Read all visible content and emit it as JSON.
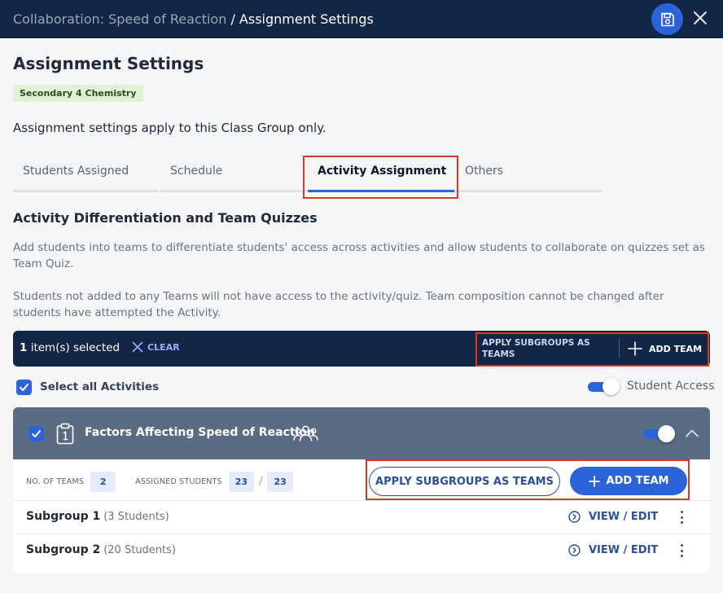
{
  "header": {
    "breadcrumb_parent": "Collaboration: Speed of Reaction",
    "breadcrumb_current": " / Assignment Settings"
  },
  "page": {
    "title": "Assignment Settings",
    "tag": "Secondary 4 Chemistry",
    "note": "Assignment settings apply to this Class Group only."
  },
  "tabs": [
    {
      "label": "Students Assigned",
      "active": false
    },
    {
      "label": "Schedule",
      "active": false
    },
    {
      "label": "Activity Assignment",
      "active": true
    },
    {
      "label": "Others",
      "active": false
    }
  ],
  "section": {
    "title": "Activity Differentiation and Team Quizzes",
    "para1": "Add students into teams to differentiate students' access across activities and allow students to collaborate on quizzes set as Team Quiz.",
    "para2": "Students not added to any Teams will not have access to the activity/quiz. Team composition cannot be changed after students have attempted the Activity."
  },
  "selection_bar": {
    "count": "1",
    "count_suffix": " item(s) selected",
    "clear_label": "CLEAR",
    "apply_label": "APPLY SUBGROUPS AS TEAMS",
    "add_label": "ADD TEAM"
  },
  "select_all": {
    "label": "Select all Activities",
    "checked": true
  },
  "student_access": {
    "label": "Student Access",
    "on": true
  },
  "activity": {
    "title": "Factors Affecting Speed of Reaction",
    "checked": true,
    "access_on": true,
    "teams_label": "NO. OF TEAMS",
    "teams_value": "2",
    "assigned_label": "ASSIGNED STUDENTS",
    "assigned_value": "23",
    "assigned_sep": "/",
    "assigned_total": "23",
    "apply_label": "APPLY SUBGROUPS AS TEAMS",
    "add_label": "ADD TEAM",
    "subgroups": [
      {
        "name": "Subgroup 1",
        "count": "(3 Students)",
        "action": "VIEW / EDIT"
      },
      {
        "name": "Subgroup 2",
        "count": "(20 Students)",
        "action": "VIEW / EDIT"
      }
    ]
  },
  "colors": {
    "header_bg": "#142645",
    "accent": "#2b63d9",
    "card_head_bg": "#5a6b84",
    "highlight": "#e0371f",
    "tag_bg": "#dff1d6"
  },
  "icons": {
    "save": "save-icon",
    "close": "close-icon",
    "clear": "close-icon",
    "add": "plus-icon",
    "activity": "clipboard-icon",
    "group": "group-icon",
    "collapse": "chevron-up-icon",
    "view": "chevron-right-circle-icon",
    "more": "kebab-icon"
  }
}
